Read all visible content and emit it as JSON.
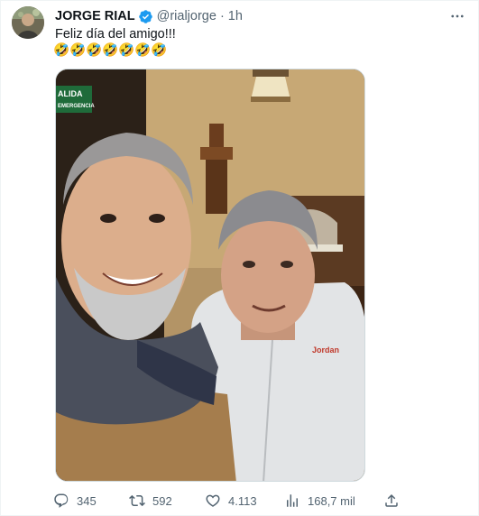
{
  "author": {
    "name": "JORGE RIAL",
    "handle": "@rialjorge",
    "separator": "·",
    "time": "1h",
    "verified_color": "#1d9bf0",
    "avatar_icon": "avatar-photo"
  },
  "tweet": {
    "text": "Feliz día del amigo!!!",
    "emojis": [
      "🤣",
      "🤣",
      "🤣",
      "🤣",
      "🤣",
      "🤣",
      "🤣"
    ]
  },
  "media": {
    "sign_text_line1": "ALIDA",
    "sign_text_line2": "EMERGENCIA",
    "jersey_brand": "Jordan"
  },
  "actions": {
    "replies": "345",
    "retweets": "592",
    "likes": "4.113",
    "views": "168,7 mil"
  },
  "colors": {
    "text_primary": "#0f1419",
    "text_secondary": "#536471",
    "brand_blue": "#1d9bf0"
  }
}
